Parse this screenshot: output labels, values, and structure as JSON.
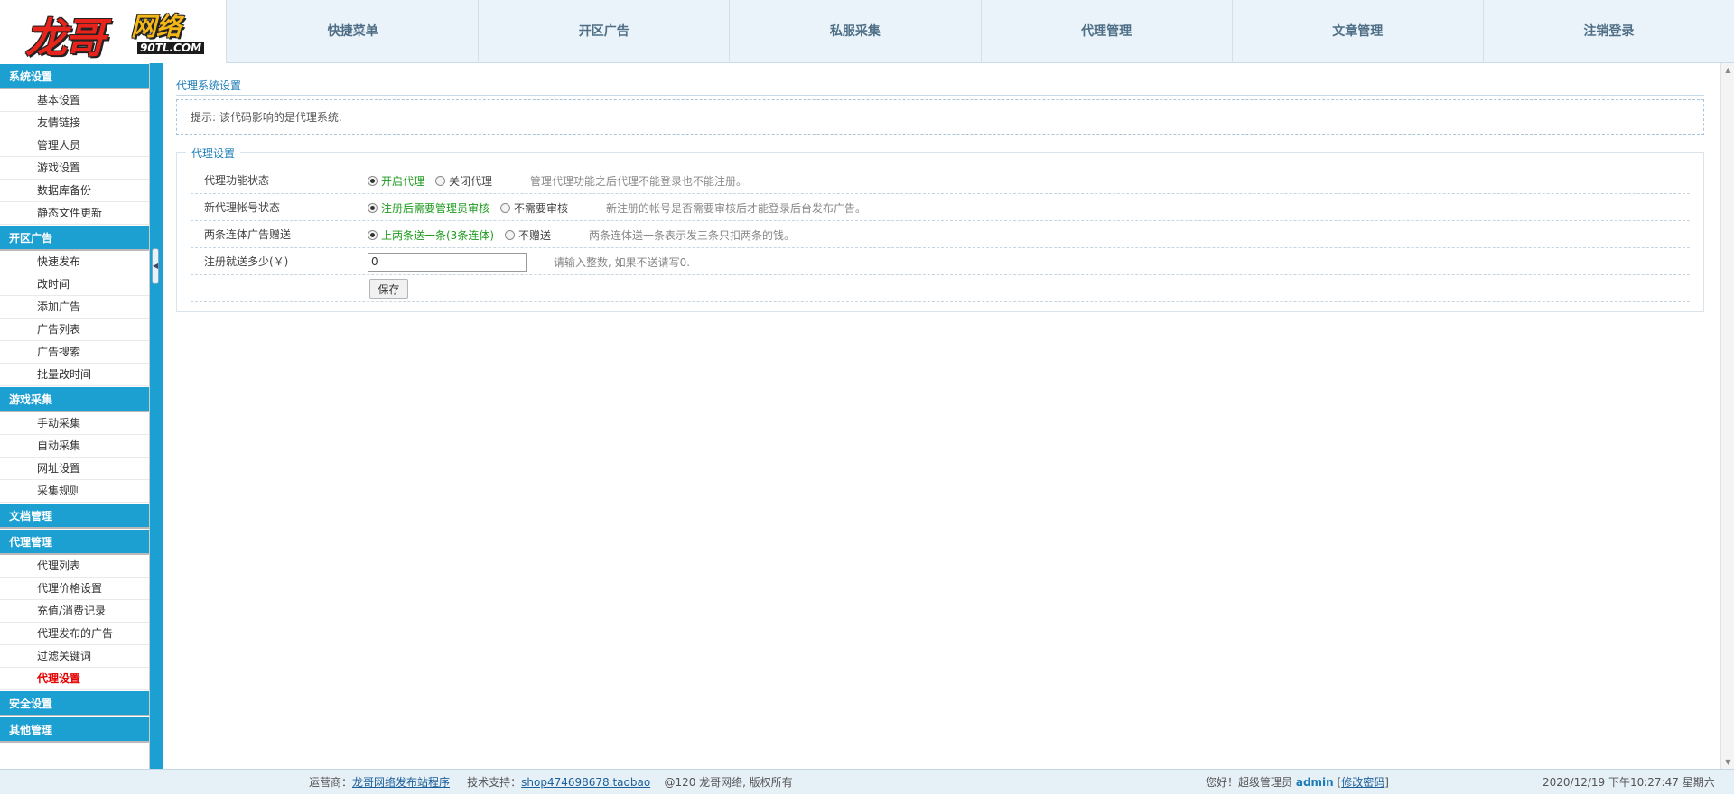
{
  "logo": {
    "main": "龙哥",
    "sub": "网络",
    "domain": "90TL.COM"
  },
  "topnav": [
    "快捷菜单",
    "开区广告",
    "私服采集",
    "代理管理",
    "文章管理",
    "注销登录"
  ],
  "sidebar": [
    {
      "title": "系统设置",
      "items": [
        "基本设置",
        "友情链接",
        "管理人员",
        "游戏设置",
        "数据库备份",
        "静态文件更新"
      ]
    },
    {
      "title": "开区广告",
      "items": [
        "快速发布",
        "改时间",
        "添加广告",
        "广告列表",
        "广告搜索",
        "批量改时间"
      ]
    },
    {
      "title": "游戏采集",
      "items": [
        "手动采集",
        "自动采集",
        "网址设置",
        "采集规则"
      ]
    },
    {
      "title": "文档管理",
      "items": []
    },
    {
      "title": "代理管理",
      "items": [
        "代理列表",
        "代理价格设置",
        "充值/消费记录",
        "代理发布的广告",
        "过滤关键词",
        "代理设置"
      ]
    },
    {
      "title": "安全设置",
      "items": []
    },
    {
      "title": "其他管理",
      "items": []
    }
  ],
  "active_item": "代理设置",
  "main": {
    "page_title": "代理系统设置",
    "tip": "提示: 该代码影响的是代理系统.",
    "section_title": "代理设置",
    "rows": [
      {
        "label": "代理功能状态",
        "options": [
          "开启代理",
          "关闭代理"
        ],
        "selected": 0,
        "hint": "管理代理功能之后代理不能登录也不能注册。"
      },
      {
        "label": "新代理帐号状态",
        "options": [
          "注册后需要管理员审核",
          "不需要审核"
        ],
        "selected": 0,
        "hint": "新注册的帐号是否需要审核后才能登录后台发布广告。"
      },
      {
        "label": "两条连体广告赠送",
        "options": [
          "上两条送一条(3条连体)",
          "不赠送"
        ],
        "selected": 0,
        "hint": "两条连体送一条表示发三条只扣两条的钱。"
      }
    ],
    "register_bonus": {
      "label": "注册就送多少(￥)",
      "value": "0",
      "hint": "请输入整数, 如果不送请写0."
    },
    "save_label": "保存"
  },
  "footer": {
    "operator_label": "运营商：",
    "operator_link": "龙哥网络发布站程序",
    "support_label": "技术支持：",
    "support_link": "shop474698678.taobao",
    "copyright": "@120 龙哥网络, 版权所有",
    "greeting": "您好！超级管理员",
    "admin": "admin",
    "bracket_open": "[",
    "change_pwd": "修改密码",
    "bracket_close": "]",
    "datetime": "2020/12/19 下午10:27:47 星期六"
  },
  "colors": {
    "accent": "#1c9fd1",
    "active": "#e40000",
    "green": "#1e9b1e"
  }
}
